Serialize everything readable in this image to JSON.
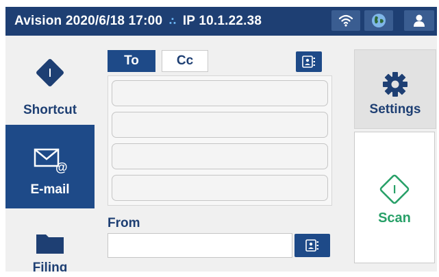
{
  "status_bar": {
    "brand": "Avision",
    "datetime": "2020/6/18 17:00",
    "ip_text": "IP 10.1.22.38",
    "icons": [
      "wifi-icon",
      "globe-icon",
      "user-icon"
    ]
  },
  "nav": {
    "items": [
      {
        "label": "Shortcut",
        "icon": "shortcut-diamond-icon",
        "active": false
      },
      {
        "label": "E-mail",
        "icon": "email-icon",
        "active": true
      },
      {
        "label": "Filing",
        "icon": "folder-icon",
        "active": false
      }
    ]
  },
  "email": {
    "tabs": [
      {
        "label": "To",
        "active": true
      },
      {
        "label": "Cc",
        "active": false
      }
    ],
    "recipient_fields": [
      "",
      "",
      "",
      ""
    ],
    "from_label": "From",
    "from_value": ""
  },
  "actions": {
    "settings_label": "Settings",
    "scan_label": "Scan"
  },
  "colors": {
    "primary": "#1e3f73",
    "active_nav": "#1e4a88",
    "scan_green": "#28a068",
    "background": "#f0f0f0"
  }
}
